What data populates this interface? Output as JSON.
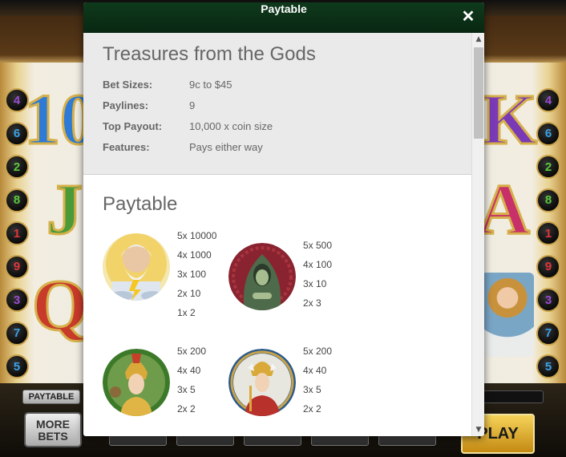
{
  "modal": {
    "title": "Paytable",
    "close_glyph": "✕"
  },
  "summary": {
    "game_title": "Treasures from the Gods",
    "rows": [
      {
        "label": "Bet Sizes:",
        "value": "9c to $45"
      },
      {
        "label": "Paylines:",
        "value": "9"
      },
      {
        "label": "Top Payout:",
        "value": "10,000 x coin size"
      },
      {
        "label": "Features:",
        "value": "Pays either way"
      }
    ]
  },
  "paytable": {
    "heading": "Paytable",
    "symbols": [
      {
        "icon": "zeus-icon",
        "pays": [
          "5x 10000",
          "4x 1000",
          "3x 100",
          "2x 10",
          "1x 2"
        ]
      },
      {
        "icon": "hooded-god-icon",
        "pays": [
          "5x 500",
          "4x 100",
          "3x 10",
          "2x 3"
        ]
      },
      {
        "icon": "athena-icon",
        "pays": [
          "5x 200",
          "4x 40",
          "3x 5",
          "2x 2"
        ]
      },
      {
        "icon": "hermes-icon",
        "pays": [
          "5x 200",
          "4x 40",
          "3x 5",
          "2x 2"
        ]
      }
    ]
  },
  "background_game": {
    "paylines_left": [
      "4",
      "6",
      "2",
      "8",
      "1",
      "9",
      "3",
      "7",
      "5"
    ],
    "paylines_right": [
      "4",
      "6",
      "2",
      "8",
      "1",
      "9",
      "3",
      "7",
      "5"
    ],
    "paylines_colors": [
      "purple",
      "blue",
      "green",
      "green",
      "red",
      "red",
      "purple",
      "blue",
      "blue"
    ],
    "paytable_button": "PAYTABLE",
    "more_bets_line1": "MORE",
    "more_bets_line2": "BETS",
    "play_button": "PLAY"
  },
  "colors": {
    "header_bg": "#0f3a1c",
    "summary_bg": "#eaeaea",
    "text": "#666666"
  }
}
